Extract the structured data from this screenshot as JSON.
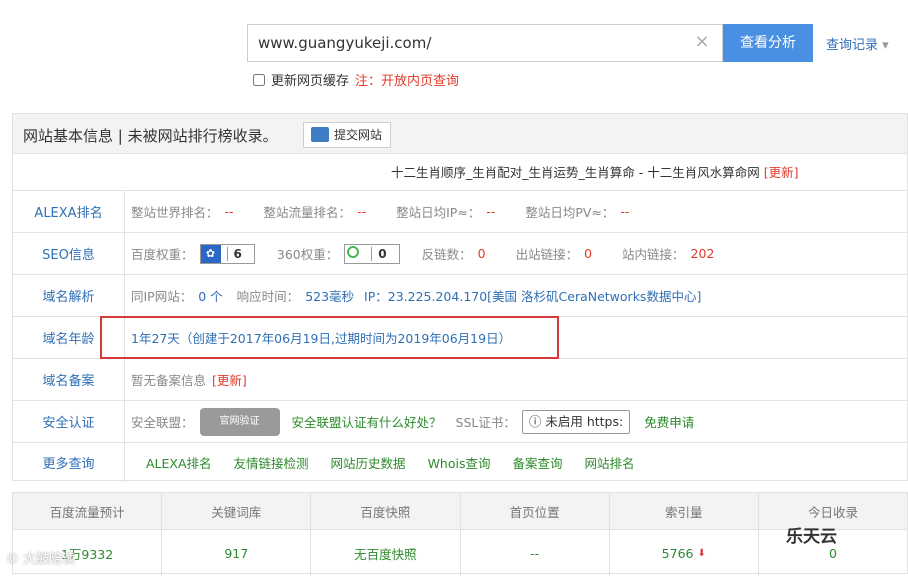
{
  "search": {
    "value": "www.guangyukeji.com/",
    "clear": "×",
    "button": "查看分析",
    "history": "查询记录",
    "history_arrow": "▾",
    "cache_label": "更新网页缓存",
    "cache_note_prefix": "注：",
    "cache_note": "开放内页查询"
  },
  "panel": {
    "title": "网站基本信息 | 未被网站排行榜收录。",
    "submit": "提交网站",
    "site_title": "十二生肖顺序_生肖配对_生肖运势_生肖算命 - 十二生肖风水算命网",
    "update": "[更新]"
  },
  "alexa": {
    "label": "ALEXA排名",
    "items": [
      {
        "name": "整站世界排名：",
        "value": "--"
      },
      {
        "name": "整站流量排名：",
        "value": "--"
      },
      {
        "name": "整站日均IP≈：",
        "value": "--"
      },
      {
        "name": "整站日均PV≈：",
        "value": "--"
      }
    ]
  },
  "seo": {
    "label": "SEO信息",
    "baidu_label": "百度权重：",
    "baidu_value": "6",
    "s360_label": "360权重：",
    "s360_value": "0",
    "backlinks_label": "反链数：",
    "backlinks_value": "0",
    "outlinks_label": "出站链接：",
    "outlinks_value": "0",
    "inlinks_label": "站内链接：",
    "inlinks_value": "202"
  },
  "dns": {
    "label": "域名解析",
    "sameip_label": "同IP网站：",
    "sameip_value": "0 个",
    "resp_label": "响应时间：",
    "resp_value": "523毫秒",
    "ip_text": "IP：23.225.204.170[美国 洛杉矶CeraNetworks数据中心]"
  },
  "age": {
    "label": "域名年龄",
    "value": "1年27天（创建于2017年06月19日,过期时间为2019年06月19日）"
  },
  "icp": {
    "label": "域名备案",
    "value": "暂无备案信息",
    "update": "[更新]"
  },
  "security": {
    "label": "安全认证",
    "alliance_label": "安全联盟：",
    "seal": "官网验证",
    "alliance_link": "安全联盟认证有什么好处？",
    "ssl_label": "SSL证书：",
    "ssl_btn": "ⓘ 未启用 https:",
    "ssl_apply": "免费申请"
  },
  "more": {
    "label": "更多查询",
    "links": [
      "ALEXA排名",
      "友情链接检测",
      "网站历史数据",
      "Whois查询",
      "备案查询",
      "网站排名"
    ]
  },
  "stats": {
    "headers": [
      "百度流量预计",
      "关键词库",
      "百度快照",
      "首页位置",
      "索引量",
      "今日收录"
    ],
    "values": [
      "1万9332",
      "917",
      "无百度快照",
      "--",
      "5766",
      "0"
    ],
    "down_arrow": "⬇"
  },
  "watermark": {
    "left": "© 大鼓陪读",
    "right": "乐天云"
  }
}
